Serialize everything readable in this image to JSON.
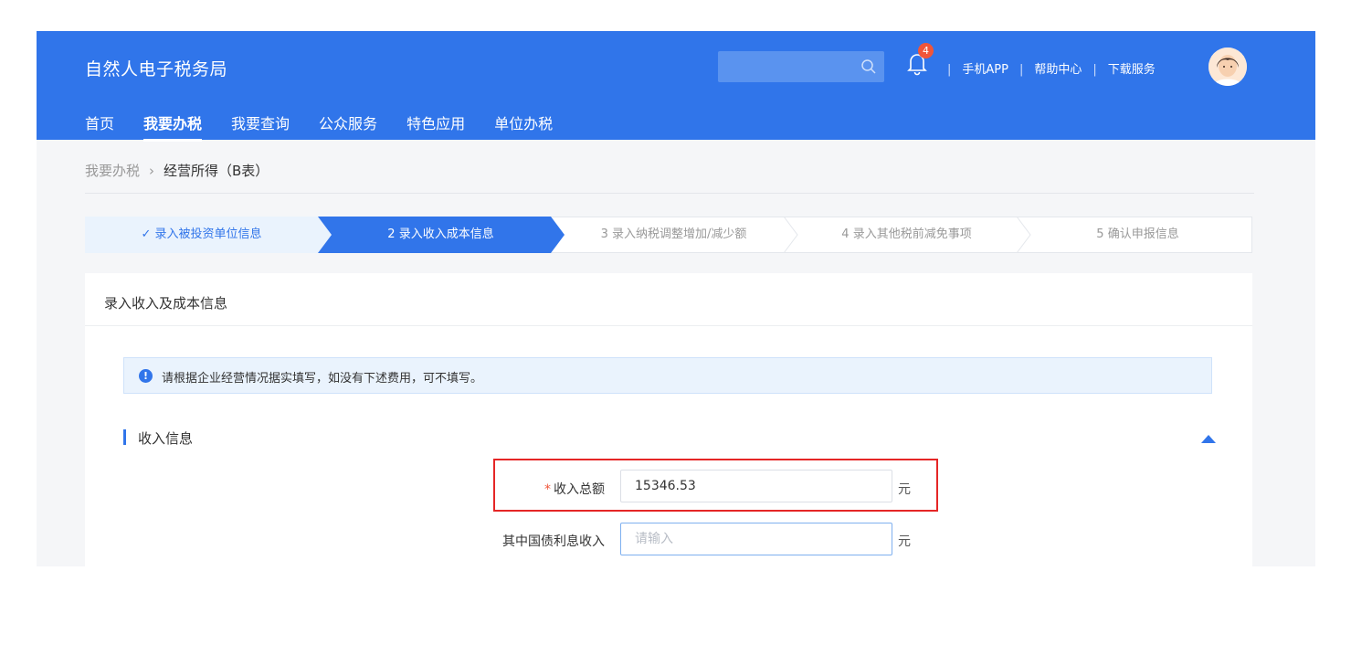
{
  "header": {
    "app_title": "自然人电子税务局",
    "notification_count": "4",
    "links": [
      "手机APP",
      "帮助中心",
      "下载服务"
    ],
    "nav": [
      {
        "label": "首页",
        "active": false
      },
      {
        "label": "我要办税",
        "active": true
      },
      {
        "label": "我要查询",
        "active": false
      },
      {
        "label": "公众服务",
        "active": false
      },
      {
        "label": "特色应用",
        "active": false
      },
      {
        "label": "单位办税",
        "active": false
      }
    ],
    "icons": {
      "search": "search-icon",
      "bell": "bell-icon",
      "avatar": "avatar"
    }
  },
  "breadcrumb": {
    "parent": "我要办税",
    "separator": "›",
    "current": "经营所得（B表）"
  },
  "steps": [
    {
      "label": "✓ 录入被投资单位信息",
      "state": "done"
    },
    {
      "label": "2  录入收入成本信息",
      "state": "active"
    },
    {
      "label": "3  录入纳税调整增加/减少额",
      "state": "pending"
    },
    {
      "label": "4  录入其他税前减免事项",
      "state": "pending"
    },
    {
      "label": "5  确认申报信息",
      "state": "pending"
    }
  ],
  "card": {
    "title": "录入收入及成本信息",
    "notice": "请根据企业经营情况据实填写，如没有下述费用，可不填写。",
    "section_title": "收入信息"
  },
  "form": {
    "total_income_label": "收入总额",
    "total_income_value": "15346.53",
    "total_income_unit": "元",
    "bond_interest_label": "其中国债利息收入",
    "bond_interest_placeholder": "请输入",
    "bond_interest_unit": "元"
  },
  "colors": {
    "brand_blue": "#3075ea",
    "step_active": "#3175ea",
    "step_done_bg": "#eaf3fd",
    "required": "#f0553a",
    "highlight": "#e52626"
  }
}
